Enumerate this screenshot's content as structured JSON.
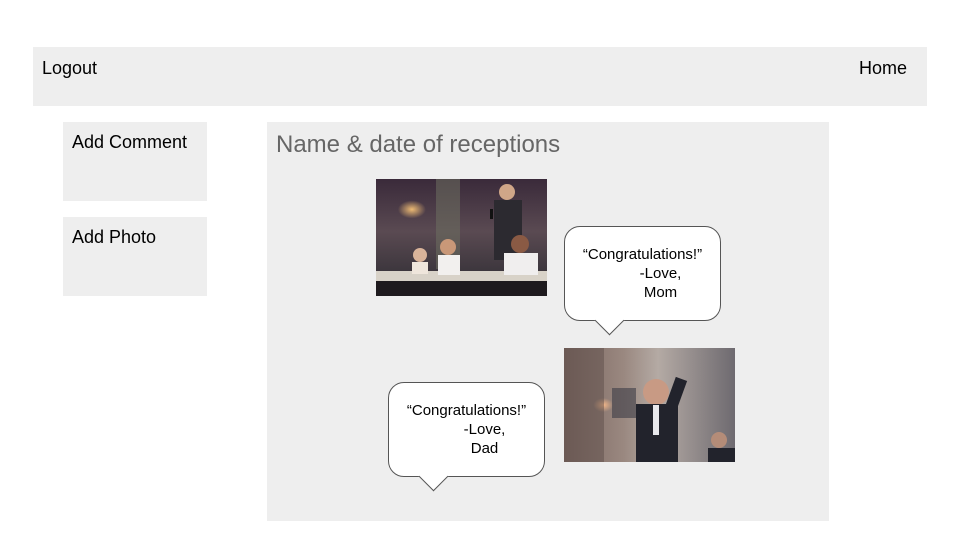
{
  "header": {
    "logout_label": "Logout",
    "home_label": "Home"
  },
  "sidebar": {
    "add_comment_label": "Add Comment",
    "add_photo_label": "Add Photo"
  },
  "main": {
    "title": "Name & date of receptions",
    "comments": [
      {
        "text": "“Congratulations!”",
        "sign_off": "-Love,",
        "author": "Mom"
      },
      {
        "text": "“Congratulations!”",
        "sign_off": "-Love,",
        "author": "Dad"
      }
    ]
  },
  "colors": {
    "panel_bg": "#eeeeee",
    "title_text": "#666666",
    "bubble_border": "#555555"
  }
}
